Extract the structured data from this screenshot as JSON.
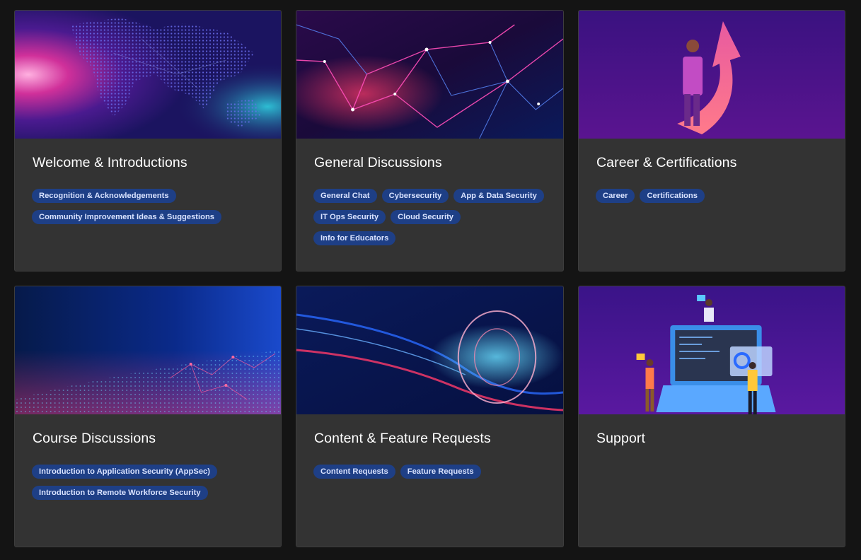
{
  "categories": [
    {
      "title": "Welcome & Introductions",
      "banner_icon": "world-map-banner",
      "tags": [
        "Recognition & Acknowledgements",
        "Community Improvement Ideas & Suggestions"
      ]
    },
    {
      "title": "General Discussions",
      "banner_icon": "network-lines-banner",
      "tags": [
        "General Chat",
        "Cybersecurity",
        "App & Data Security",
        "IT Ops Security",
        "Cloud Security",
        "Info for Educators"
      ]
    },
    {
      "title": "Career & Certifications",
      "banner_icon": "career-arrow-banner",
      "tags": [
        "Career",
        "Certifications"
      ]
    },
    {
      "title": "Course Discussions",
      "banner_icon": "network-particles-banner",
      "tags": [
        "Introduction to Application Security (AppSec)",
        "Introduction to Remote Workforce Security"
      ]
    },
    {
      "title": "Content & Feature Requests",
      "banner_icon": "digital-ring-banner",
      "tags": [
        "Content Requests",
        "Feature Requests"
      ]
    },
    {
      "title": "Support",
      "banner_icon": "laptop-support-banner",
      "tags": []
    }
  ],
  "colors": {
    "page_bg": "#141414",
    "card_bg": "#333333",
    "tag_bg": "#1e3f86",
    "tag_text": "#d8e2ff",
    "title_text": "#ffffff"
  }
}
